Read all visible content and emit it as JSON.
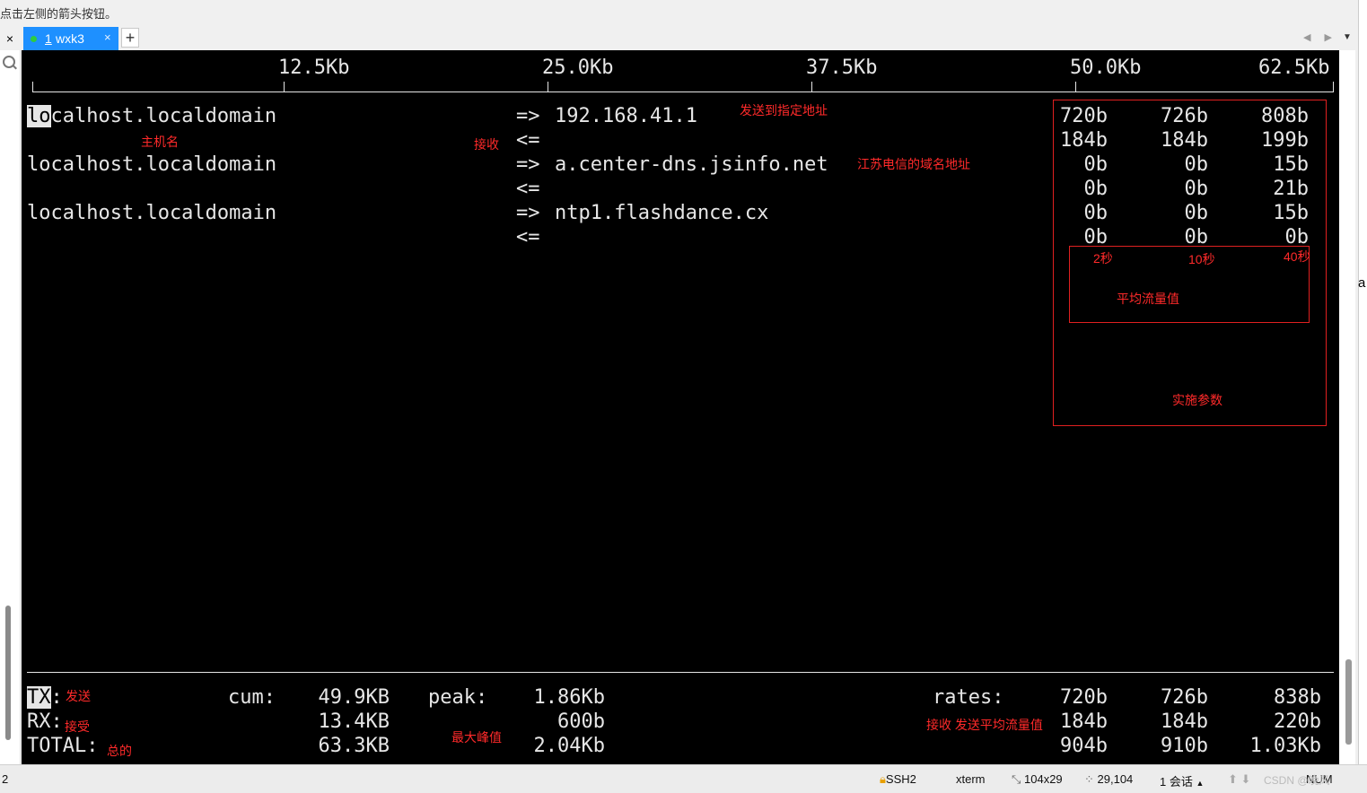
{
  "window": {
    "hint_text": "点击左侧的箭头按钮。",
    "close_glyph": "×",
    "tab": {
      "number": "1",
      "name": "wxk3",
      "close_glyph": "×"
    },
    "add_tab_glyph": "+",
    "nav_arrows": "◀ ▶",
    "menu_arrow": "▼",
    "right_edge_text": "a"
  },
  "terminal": {
    "scale": [
      "12.5Kb",
      "25.0Kb",
      "37.5Kb",
      "50.0Kb",
      "62.5Kb"
    ],
    "connections": [
      {
        "host_hl": "lo",
        "host_rest": "calhost.localdomain",
        "send_arrow": "=>",
        "recv_arrow": "<=",
        "dest": "192.168.41.1",
        "tx_rates": [
          "720b",
          "726b",
          "808b"
        ],
        "rx_rates": [
          "184b",
          "184b",
          "199b"
        ]
      },
      {
        "host_hl": "",
        "host_rest": "localhost.localdomain",
        "send_arrow": "=>",
        "recv_arrow": "<=",
        "dest": "a.center-dns.jsinfo.net",
        "tx_rates": [
          "0b",
          "0b",
          "15b"
        ],
        "rx_rates": [
          "0b",
          "0b",
          "21b"
        ]
      },
      {
        "host_hl": "",
        "host_rest": "localhost.localdomain",
        "send_arrow": "=>",
        "recv_arrow": "<=",
        "dest": "ntp1.flashdance.cx",
        "tx_rates": [
          "0b",
          "0b",
          "15b"
        ],
        "rx_rates": [
          "0b",
          "0b",
          "0b"
        ]
      }
    ],
    "totals": {
      "tx_label": "TX",
      "rx_label": "RX:",
      "total_label": "TOTAL:",
      "colon": ":",
      "cum_label": "cum:",
      "peak_label": "peak:",
      "rates_label": "rates:",
      "cum": [
        "49.9KB",
        "13.4KB",
        "63.3KB"
      ],
      "peak": [
        "1.86Kb",
        "600b",
        "2.04Kb"
      ],
      "rates": [
        [
          "720b",
          "726b",
          "838b"
        ],
        [
          "184b",
          "184b",
          "220b"
        ],
        [
          "904b",
          "910b",
          "1.03Kb"
        ]
      ]
    }
  },
  "annotations": {
    "send_to": "发送到指定地址",
    "hostname": "主机名",
    "receive": "接收",
    "jiangsu_dns": "江苏电信的域名地址",
    "sec_2": "2秒",
    "sec_10": "10秒",
    "sec_40": "40秒",
    "avg_flow": "平均流量值",
    "actual_params": "实施参数",
    "tx_send": "发送",
    "rx_accept": "接受",
    "total_total": "总的",
    "max_peak": "最大峰值",
    "recv_send_avg": "接收 发送平均流量值"
  },
  "statusbar": {
    "left_num": "2",
    "protocol": "SSH2",
    "term_type": "xterm",
    "size": "104x29",
    "cursor": "29,104",
    "sessions": "1 会话",
    "num": "NUM",
    "watermark": "CSDN @晚风"
  }
}
